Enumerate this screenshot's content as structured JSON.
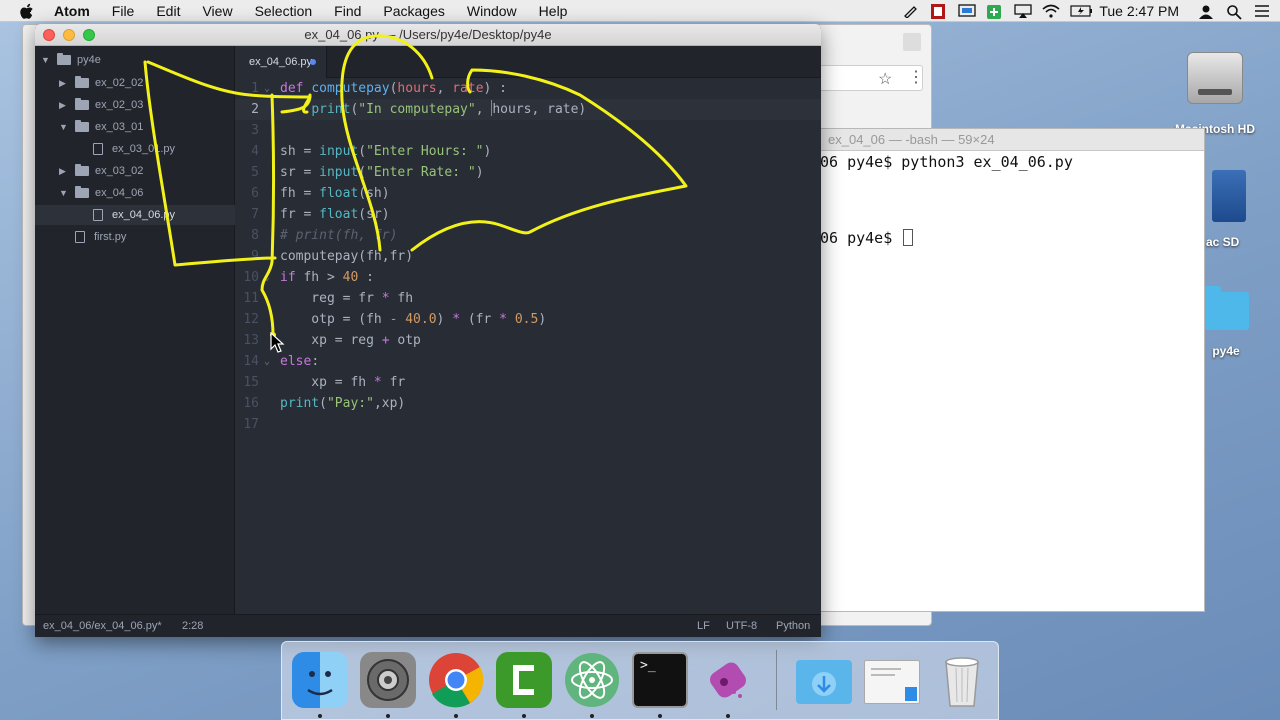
{
  "menubar": {
    "app_name": "Atom",
    "items": [
      "File",
      "Edit",
      "View",
      "Selection",
      "Find",
      "Packages",
      "Window",
      "Help"
    ],
    "clock": "Tue 2:47 PM",
    "status_icons": [
      "pen-icon",
      "record-icon",
      "display-icon",
      "battery-cell-icon",
      "airplay-icon",
      "wifi-icon",
      "battery-icon",
      "user-icon",
      "spotlight-icon",
      "list-icon"
    ]
  },
  "atom_window": {
    "title": "ex_04_06.py — /Users/py4e/Desktop/py4e",
    "tree": {
      "root": "py4e",
      "items": [
        {
          "label": "ex_02_02",
          "type": "folder",
          "expanded": false,
          "depth": 1
        },
        {
          "label": "ex_02_03",
          "type": "folder",
          "expanded": false,
          "depth": 1
        },
        {
          "label": "ex_03_01",
          "type": "folder",
          "expanded": true,
          "depth": 1
        },
        {
          "label": "ex_03_01.py",
          "type": "file",
          "depth": 2
        },
        {
          "label": "ex_03_02",
          "type": "folder",
          "expanded": false,
          "depth": 1
        },
        {
          "label": "ex_04_06",
          "type": "folder",
          "expanded": true,
          "depth": 1
        },
        {
          "label": "ex_04_06.py",
          "type": "file",
          "depth": 2,
          "selected": true
        },
        {
          "label": "first.py",
          "type": "file",
          "depth": 1
        }
      ]
    },
    "tab": {
      "label": "ex_04_06.py",
      "modified": true
    },
    "code_lines": [
      "def computepay(hours, rate) :",
      "    print(\"In computepay\", hours, rate)",
      "",
      "sh = input(\"Enter Hours: \")",
      "sr = input(\"Enter Rate: \")",
      "fh = float(sh)",
      "fr = float(sr)",
      "# print(fh, fr)",
      "computepay(fh,fr)",
      "if fh > 40 :",
      "    reg = fr * fh",
      "    otp = (fh - 40.0) * (fr * 0.5)",
      "    xp = reg + otp",
      "else:",
      "    xp = fh * fr",
      "print(\"Pay:\",xp)",
      ""
    ],
    "active_line": 2,
    "status": {
      "path": "ex_04_06/ex_04_06.py*",
      "cursor": "2:28",
      "line_ending": "LF",
      "encoding": "UTF-8",
      "grammar": "Python"
    }
  },
  "terminal": {
    "title": "ex_04_06 — -bash — 59×24",
    "lines": [
      "06 py4e$ python3 ex_04_06.py",
      "06 py4e$ "
    ]
  },
  "desktop_icons": [
    {
      "label": "Macintosh HD",
      "icon": "hard-drive-icon"
    },
    {
      "label": "ac SD",
      "icon": "sd-card-icon"
    },
    {
      "label": "py4e",
      "icon": "folder-icon"
    }
  ],
  "dock": {
    "apps": [
      "finder-icon",
      "system-preferences-icon",
      "chrome-icon",
      "camtasia-icon",
      "atom-icon",
      "terminal-icon",
      "screen-recorder-icon",
      "downloads-icon",
      "desktop-stack-icon",
      "trash-icon"
    ],
    "terminal_glyph": ">_"
  },
  "colors": {
    "annotation": "#f2f21a",
    "atom_bg": "#282c34",
    "atom_chrome": "#21252b",
    "keyword": "#c678dd",
    "function": "#61afef",
    "string": "#98c379",
    "number": "#d19a66"
  }
}
